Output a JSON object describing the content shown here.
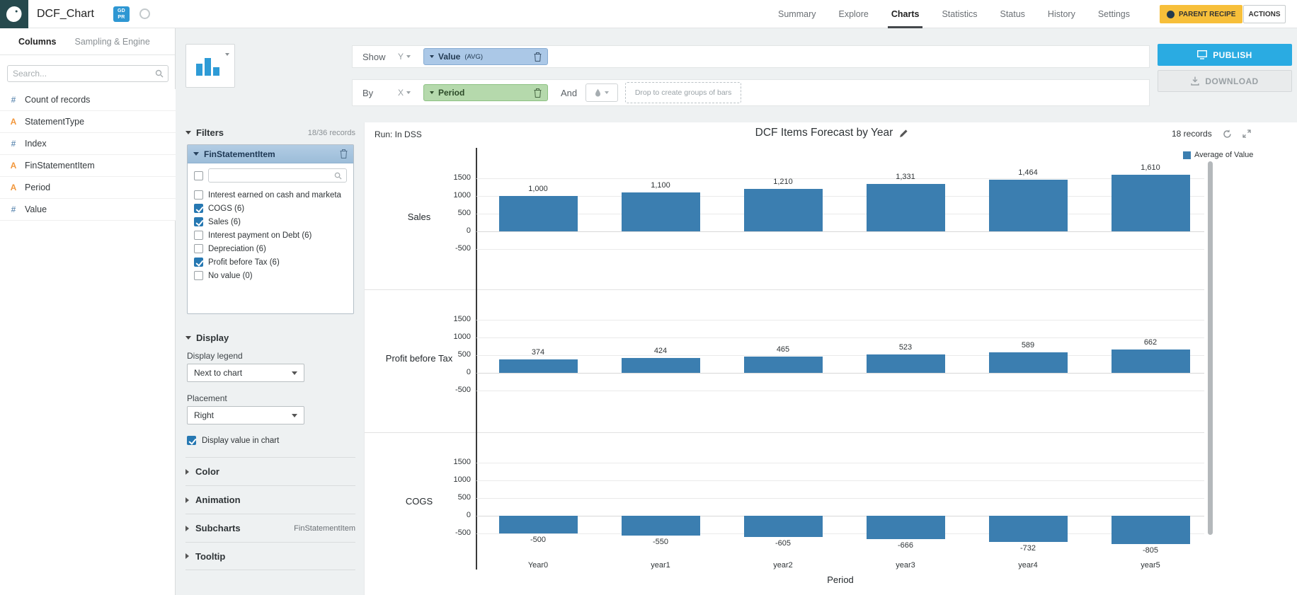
{
  "header": {
    "title": "DCF_Chart",
    "badge_top": "GD",
    "badge_bottom": "PR",
    "nav_items": [
      "Summary",
      "Explore",
      "Charts",
      "Statistics",
      "Status",
      "History",
      "Settings"
    ],
    "active_nav": "Charts",
    "parent_recipe_label": "PARENT RECIPE",
    "actions_label": "ACTIONS"
  },
  "sidebar": {
    "tab_columns": "Columns",
    "tab_sampling": "Sampling & Engine",
    "search_placeholder": "Search...",
    "columns": [
      {
        "type": "#",
        "name": "Count of records",
        "kind": "numeric"
      },
      {
        "type": "A",
        "name": "StatementType",
        "kind": "text"
      },
      {
        "type": "#",
        "name": "Index",
        "kind": "numeric"
      },
      {
        "type": "A",
        "name": "FinStatementItem",
        "kind": "text"
      },
      {
        "type": "A",
        "name": "Period",
        "kind": "text"
      },
      {
        "type": "#",
        "name": "Value",
        "kind": "numeric"
      }
    ]
  },
  "controls": {
    "show_label": "Show",
    "y_label": "Y",
    "y_pill": "Value",
    "y_agg": "(AVG)",
    "by_label": "By",
    "x_label": "X",
    "x_pill": "Period",
    "and_label": "And",
    "dropzone_text": "Drop to create groups of bars",
    "publish_label": "PUBLISH",
    "download_label": "DOWNLOAD"
  },
  "filters": {
    "section_title": "Filters",
    "records_label": "18/36 records",
    "filter_title": "FinStatementItem",
    "items": [
      {
        "label": "Interest earned on cash and marketa",
        "checked": false
      },
      {
        "label": "COGS (6)",
        "checked": true
      },
      {
        "label": "Sales (6)",
        "checked": true
      },
      {
        "label": "Interest payment on Debt (6)",
        "checked": false
      },
      {
        "label": "Depreciation (6)",
        "checked": false
      },
      {
        "label": "Profit before Tax (6)",
        "checked": true
      },
      {
        "label": "No value (0)",
        "checked": false
      }
    ]
  },
  "display": {
    "section_title": "Display",
    "legend_label": "Display legend",
    "legend_value": "Next to chart",
    "placement_label": "Placement",
    "placement_value": "Right",
    "value_in_chart_label": "Display value in chart",
    "value_in_chart_checked": true
  },
  "sections": [
    {
      "title": "Color",
      "value": ""
    },
    {
      "title": "Animation",
      "value": ""
    },
    {
      "title": "Subcharts",
      "value": "FinStatementItem"
    },
    {
      "title": "Tooltip",
      "value": ""
    }
  ],
  "chart": {
    "run_label": "Run: In DSS",
    "records_label": "18 records"
  },
  "chart_data": {
    "type": "bar",
    "title": "DCF Items Forecast by Year",
    "xlabel": "Period",
    "legend": [
      {
        "name": "Average of Value",
        "color": "#3b7eb0"
      }
    ],
    "legend_position": "right",
    "bar_color": "#3b7eb0",
    "grid": true,
    "categories": [
      "Year0",
      "year1",
      "year2",
      "year3",
      "year4",
      "year5"
    ],
    "y_ticks": [
      1500,
      1000,
      500,
      0,
      -500
    ],
    "ylim": [
      -900,
      1800
    ],
    "facets": [
      {
        "name": "Sales",
        "values": [
          1000,
          1100,
          1210,
          1331,
          1464,
          1610
        ],
        "labels": [
          "1,000",
          "1,100",
          "1,210",
          "1,331",
          "1,464",
          "1,610"
        ]
      },
      {
        "name": "Profit before Tax",
        "values": [
          374,
          424,
          465,
          523,
          589,
          662
        ],
        "labels": [
          "374",
          "424",
          "465",
          "523",
          "589",
          "662"
        ]
      },
      {
        "name": "COGS",
        "values": [
          -500,
          -550,
          -605,
          -666,
          -732,
          -805
        ],
        "labels": [
          "-500",
          "-550",
          "-605",
          "-666",
          "-732",
          "-805"
        ]
      }
    ]
  }
}
